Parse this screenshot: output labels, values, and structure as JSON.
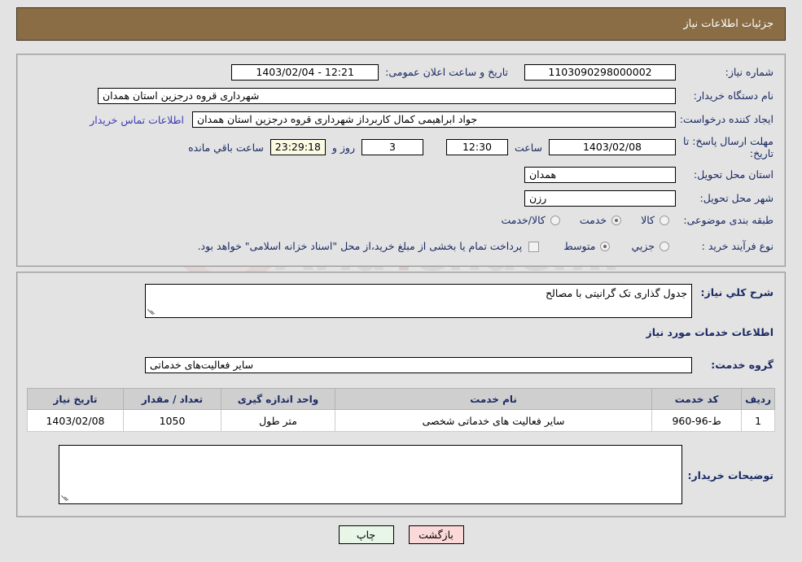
{
  "header": {
    "title": "جزئیات اطلاعات نیاز"
  },
  "watermark": {
    "text": "AriaTender.ir",
    "shield": "shield-logo"
  },
  "colors": {
    "header_bar": "#8a6d45",
    "label": "#1a2a63",
    "link": "#3b3bb5",
    "page_bg": "#e3e3e3",
    "countdown_bg": "#fbfbe4",
    "back_button": "#fbd9d9",
    "print_button": "#e7f6e7",
    "table_header": "#cfcfcf"
  },
  "top_panel": {
    "need_number": {
      "label": "شماره نیاز:",
      "value": "1103090298000002"
    },
    "public_announce": {
      "label": "تاریخ و ساعت اعلان عمومی:",
      "value": "1403/02/04 - 12:21"
    },
    "buyer_org": {
      "label": "نام دستگاه خریدار:",
      "value": "شهرداری قروه درجزین استان همدان"
    },
    "creator": {
      "label": "ایجاد کننده درخواست:",
      "value": "جواد  ابراهیمی کمال  کاربرداز  شهرداری قروه درجزین استان همدان",
      "contact_link": "اطلاعات تماس خریدار"
    },
    "deadline": {
      "label": "مهلت ارسال پاسخ: تا تاریخ:",
      "date": "1403/02/08",
      "hour_label": "ساعت",
      "hour": "12:30",
      "days": "3",
      "days_label": "روز و",
      "countdown": "23:29:18",
      "countdown_label": "ساعت باقي مانده"
    },
    "province": {
      "label": "استان محل تحویل:",
      "value": "همدان"
    },
    "city": {
      "label": "شهر محل تحویل:",
      "value": "رزن"
    },
    "category": {
      "label": "طبقه بندی موضوعی:",
      "options": [
        {
          "label": "کالا",
          "selected": false
        },
        {
          "label": "خدمت",
          "selected": true
        },
        {
          "label": "کالا/خدمت",
          "selected": false
        }
      ]
    },
    "process_type": {
      "label": "نوع فرآیند خرید :",
      "options": [
        {
          "label": "جزیي",
          "selected": false
        },
        {
          "label": "متوسط",
          "selected": true
        }
      ],
      "checkbox_label": "پرداخت تمام یا بخشی از مبلغ خرید،از محل \"اسناد خزانه اسلامی\" خواهد بود.",
      "checkbox_checked": false
    }
  },
  "mid_panel": {
    "general_desc": {
      "label": "شرح کلي نیاز:",
      "value": "جدول گذاری تک گرانیتی با مصالح"
    },
    "section_title": "اطلاعات خدمات مورد نیاز",
    "service_group": {
      "label": "گروه خدمت:",
      "value": "سایر فعالیت‌های خدماتی"
    },
    "table": {
      "columns": [
        "ردیف",
        "کد خدمت",
        "نام خدمت",
        "واحد اندازه گیری",
        "تعداد / مقدار",
        "تاریخ نیاز"
      ],
      "rows": [
        {
          "row": "1",
          "service_code": "960-96-ط",
          "service_name": "سایر فعالیت های خدماتی شخصی",
          "unit": "متر طول",
          "quantity": "1050",
          "need_date": "1403/02/08"
        }
      ]
    },
    "buyer_notes": {
      "label": "توضیحات خریدار:",
      "value": ""
    }
  },
  "buttons": {
    "back": "بازگشت",
    "print": "چاپ"
  }
}
